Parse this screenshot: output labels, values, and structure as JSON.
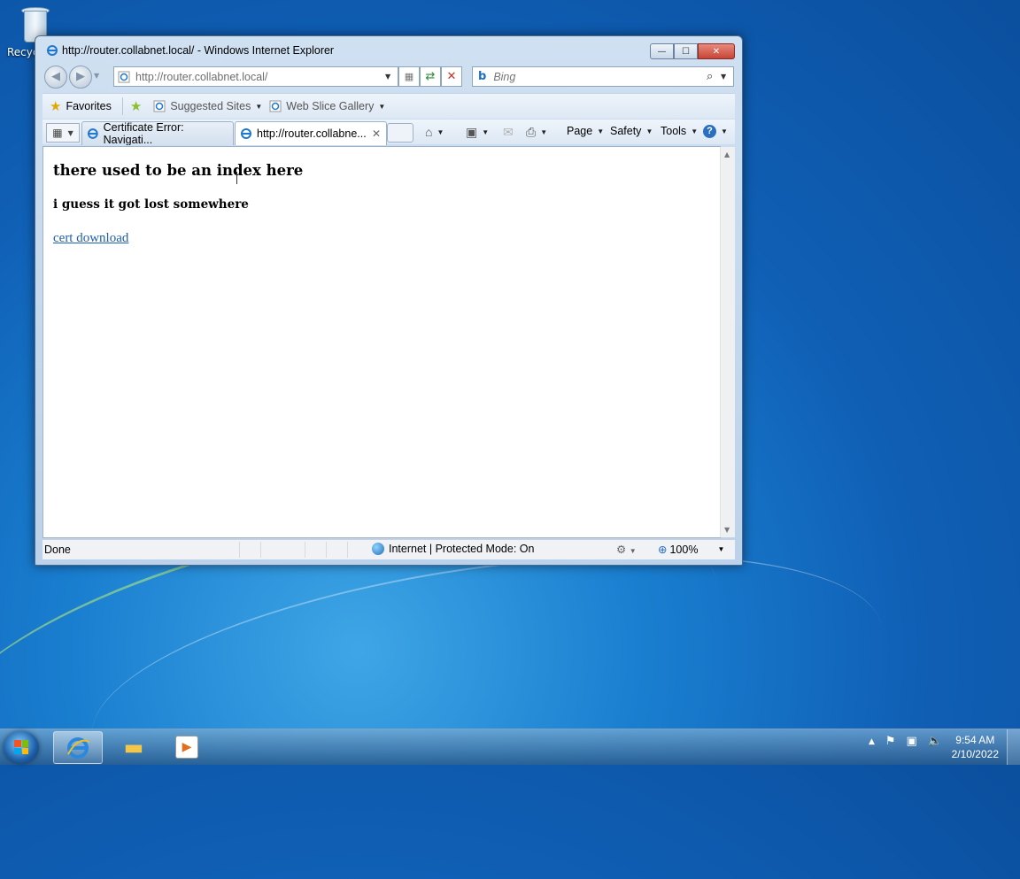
{
  "desktop": {
    "recycle_label": "Recyc"
  },
  "window": {
    "title": "http://router.collabnet.local/ - Windows Internet Explorer",
    "min": "—",
    "max": "☐",
    "close": "✕"
  },
  "address": {
    "url": "http://router.collabnet.local/"
  },
  "search": {
    "placeholder": "Bing"
  },
  "favorites": {
    "favorites_label": "Favorites",
    "suggested_sites": "Suggested Sites",
    "web_slice_gallery": "Web Slice Gallery"
  },
  "tabs": [
    {
      "label": "Certificate Error: Navigati...",
      "active": false
    },
    {
      "label": "http://router.collabne...",
      "active": true
    }
  ],
  "command_bar": {
    "page": "Page",
    "safety": "Safety",
    "tools": "Tools",
    "help": "?"
  },
  "page": {
    "heading1": "there used to be an index here",
    "heading2": "i guess it got lost somewhere",
    "link": "cert download"
  },
  "status_bar": {
    "status": "Done",
    "zone": "Internet | Protected Mode: On",
    "zoom": "100%"
  },
  "taskbar": {
    "time": "9:54 AM",
    "date": "2/10/2022"
  },
  "colors": {
    "link": "#1f5fb0",
    "desktop_bg": "#1a7fd0"
  }
}
